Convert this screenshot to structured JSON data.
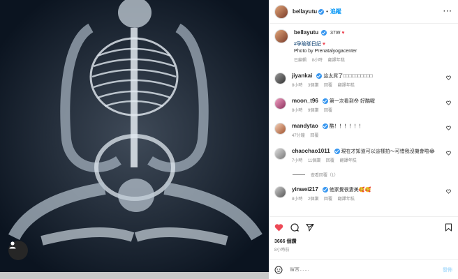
{
  "post": {
    "username": "bellayutu",
    "follow_label": "追蹤",
    "caption": {
      "time_short": "37W",
      "hashtag": "#孕瑜珈日記",
      "credit": "Photo by Prenatalyogacenter",
      "edited": "已編輯",
      "time": "8小時",
      "translate": "翻譯年糕"
    }
  },
  "comments": [
    {
      "username": "jiyankai",
      "verified": true,
      "text": "這太屌了",
      "text_extra": "□□□□□□□□□□",
      "time": "8小時",
      "likes": "3個讚",
      "reply": "回覆",
      "translate": "翻譯年糕"
    },
    {
      "username": "moon_t96",
      "verified": true,
      "text": "第一次看到😳 好酷喔",
      "time": "8小時",
      "likes": "9個讚",
      "reply": "回覆",
      "translate": ""
    },
    {
      "username": "mandytao",
      "verified": true,
      "text": "酷！！！！！！",
      "time": "47分鐘",
      "likes": "",
      "reply": "回覆",
      "translate": ""
    },
    {
      "username": "chaochao1011",
      "verified": true,
      "text": "現在才知道可以這樣拍～可惜我沒機會啦😂",
      "time": "7小時",
      "likes": "11個讚",
      "reply": "回覆",
      "translate": "翻譯年糕"
    },
    {
      "username": "yinwei217",
      "verified": true,
      "text": "他家覺很妻美🥰🥰",
      "time": "8小時",
      "likes": "2個讚",
      "reply": "回覆",
      "translate": "翻譯年糕"
    }
  ],
  "view_replies": "查看回覆（1）",
  "likes_count": "3666 個讚",
  "posted_ago": "8小時前",
  "composer": {
    "placeholder": "留言……",
    "post_label": "發佈"
  },
  "colors": {
    "accent": "#0095f6",
    "heart": "#ed4956"
  }
}
